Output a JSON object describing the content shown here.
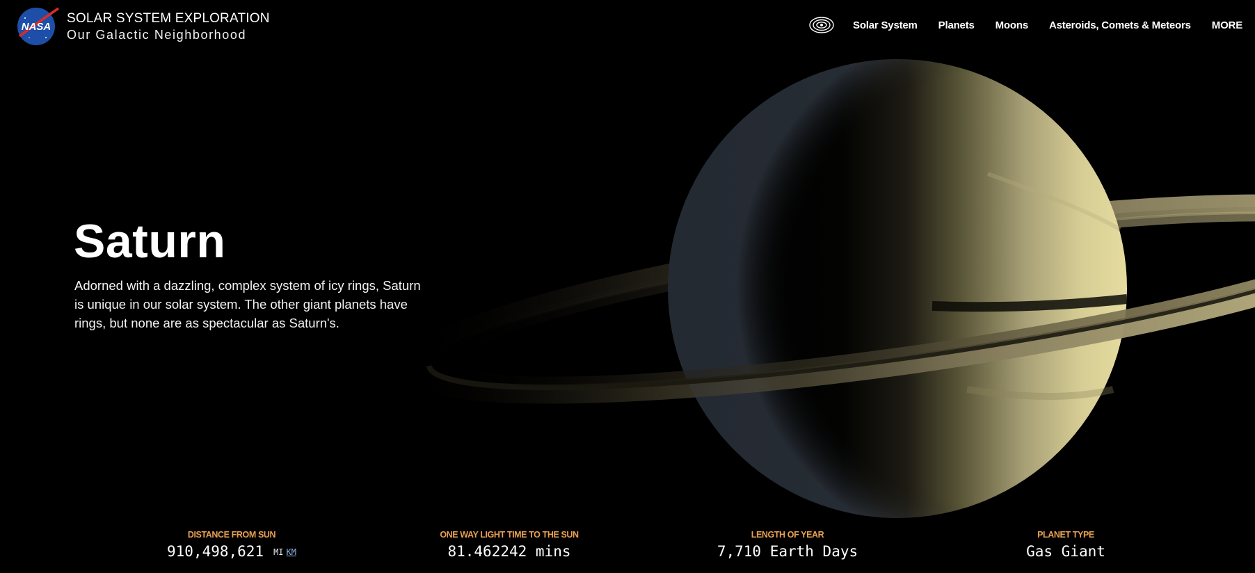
{
  "header": {
    "site_title": "SOLAR SYSTEM EXPLORATION",
    "site_subtitle": "Our Galactic Neighborhood",
    "logo": {
      "text": "NASA",
      "icon": "nasa-meatball-logo"
    },
    "nav": {
      "icon": "orbit-icon",
      "items": [
        "Solar System",
        "Planets",
        "Moons",
        "Asteroids, Comets & Meteors",
        "MORE"
      ]
    }
  },
  "hero": {
    "title": "Saturn",
    "description": "Adorned with a dazzling, complex system of icy rings, Saturn is unique in our solar system. The other giant planets have rings, but none are as spectacular as Saturn's."
  },
  "stats": [
    {
      "label": "DISTANCE FROM SUN",
      "value": "910,498,621",
      "unit_primary": "MI",
      "unit_alt": "KM"
    },
    {
      "label": "ONE WAY LIGHT TIME TO THE SUN",
      "value": "81.462242 mins"
    },
    {
      "label": "LENGTH OF YEAR",
      "value": "7,710 Earth Days"
    },
    {
      "label": "PLANET TYPE",
      "value": "Gas Giant"
    }
  ],
  "colors": {
    "background": "#000000",
    "stat_label": "#e8a052",
    "unit_link": "#8fb4e8",
    "planet_lit": "#d9cf98"
  }
}
